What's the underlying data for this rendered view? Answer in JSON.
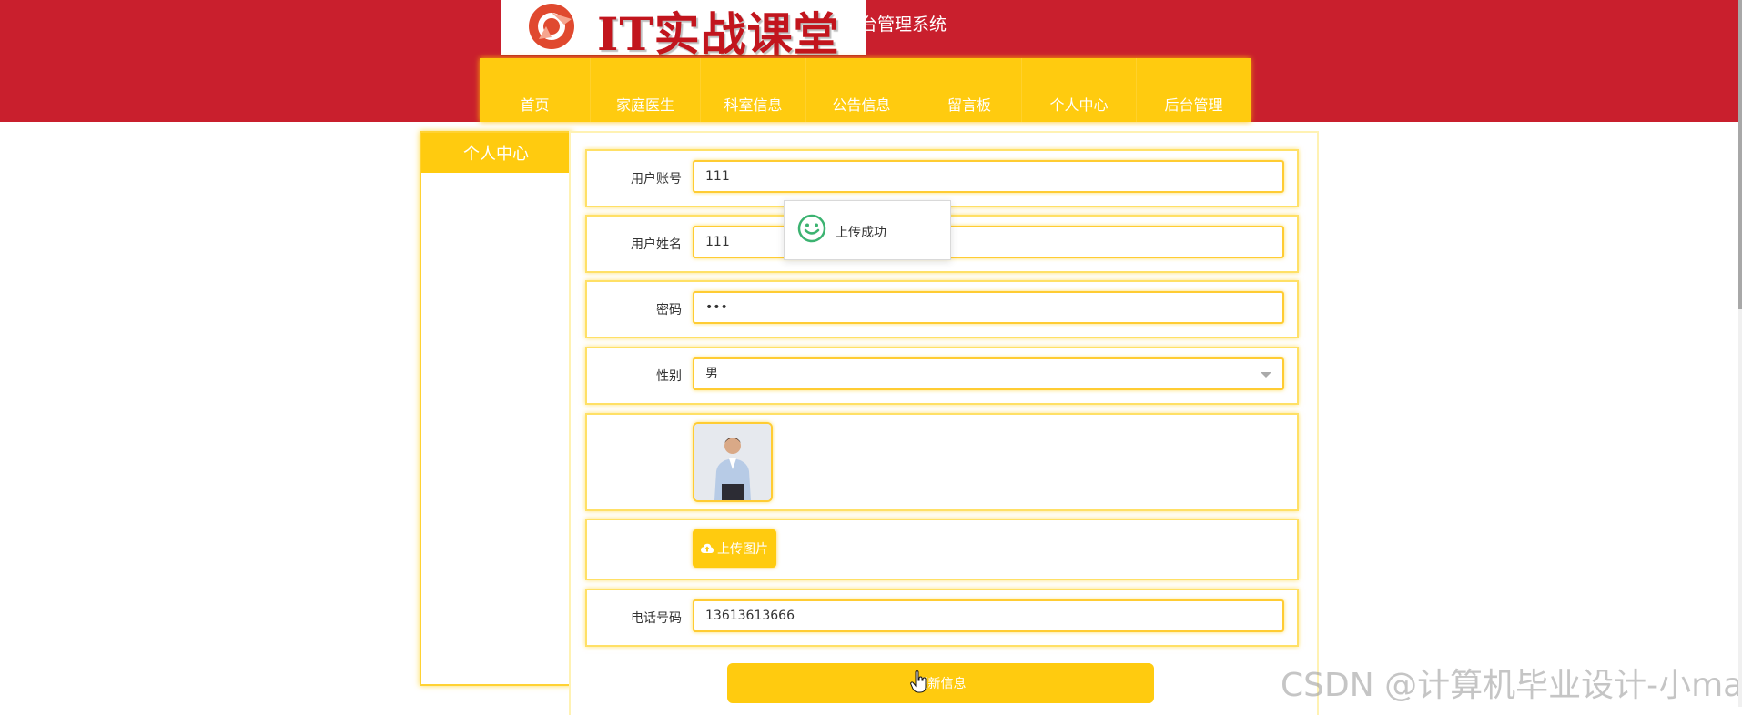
{
  "header": {
    "logo_text": "IT实战课堂",
    "site_title": "台管理系统",
    "brand_color": "#c91f2d",
    "accent_color": "#ffcb0f"
  },
  "nav": {
    "items": [
      {
        "label": "首页"
      },
      {
        "label": "家庭医生"
      },
      {
        "label": "科室信息"
      },
      {
        "label": "公告信息"
      },
      {
        "label": "留言板"
      },
      {
        "label": "个人中心"
      },
      {
        "label": "后台管理"
      }
    ]
  },
  "sidebar": {
    "title": "个人中心"
  },
  "form": {
    "account": {
      "label": "用户账号",
      "value": "111"
    },
    "name": {
      "label": "用户姓名",
      "value": "111"
    },
    "password": {
      "label": "密码",
      "value": "111"
    },
    "gender": {
      "label": "性别",
      "value": "男"
    },
    "avatar": {
      "icon": "user-photo"
    },
    "upload_button": {
      "label": "上传图片",
      "icon": "cloud-upload-icon"
    },
    "phone": {
      "label": "电话号码",
      "value": "13613613666"
    },
    "update_button": {
      "label": "更新信息"
    }
  },
  "toast": {
    "message": "上传成功",
    "icon": "smile-icon"
  },
  "watermark": {
    "text": "CSDN @计算机毕业设计-小ma"
  }
}
